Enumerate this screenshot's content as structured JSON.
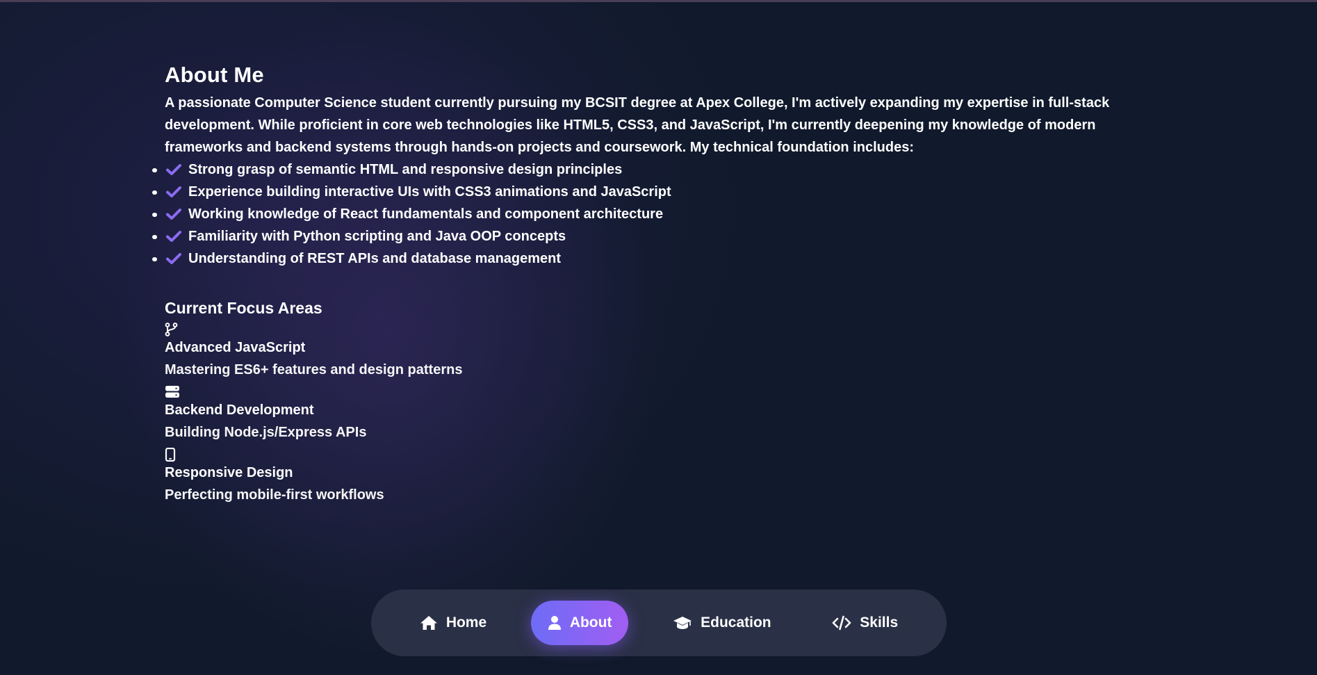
{
  "about": {
    "title": "About Me",
    "intro": "A passionate Computer Science student currently pursuing my BCSIT degree at Apex College, I'm actively expanding my expertise in full-stack development. While proficient in core web technologies like HTML5, CSS3, and JavaScript, I'm currently deepening my knowledge of modern frameworks and backend systems through hands-on projects and coursework. My technical foundation includes:",
    "points": [
      "Strong grasp of semantic HTML and responsive design principles",
      "Experience building interactive UIs with CSS3 animations and JavaScript",
      "Working knowledge of React fundamentals and component architecture",
      "Familiarity with Python scripting and Java OOP concepts",
      "Understanding of REST APIs and database management"
    ],
    "check_icon": "check-icon",
    "accent_color": "#8b6cf0"
  },
  "focus": {
    "title": "Current Focus Areas",
    "items": [
      {
        "icon": "code-branch-icon",
        "title": "Advanced JavaScript",
        "desc": "Mastering ES6+ features and design patterns"
      },
      {
        "icon": "server-icon",
        "title": "Backend Development",
        "desc": "Building Node.js/Express APIs"
      },
      {
        "icon": "mobile-icon",
        "title": "Responsive Design",
        "desc": "Perfecting mobile-first workflows"
      }
    ]
  },
  "nav": {
    "items": [
      {
        "label": "Home",
        "icon": "home-icon",
        "active": false
      },
      {
        "label": "About",
        "icon": "user-icon",
        "active": true
      },
      {
        "label": "Education",
        "icon": "graduation-cap-icon",
        "active": false
      },
      {
        "label": "Skills",
        "icon": "code-icon",
        "active": false
      }
    ],
    "active_gradient": [
      "#6d6cf6",
      "#a15ef2"
    ],
    "background": "#2a3046"
  }
}
